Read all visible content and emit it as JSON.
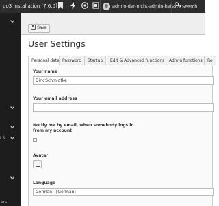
{
  "topbar": {
    "brand": "po3 Installation [7.6.0]",
    "icons": [
      "bookmark-icon",
      "flash-icon",
      "help-icon",
      "system-info-icon"
    ],
    "user_name": "admin-der-nicht-admin-heisst",
    "user_caret": "▾",
    "search_label": "Search"
  },
  "sidebar": {
    "items": [
      {
        "icon": "chevron-down-icon"
      },
      {
        "icon": "chevron-down-icon"
      },
      {
        "icon": "chevron-down-icon"
      },
      {
        "icon": "chevron-down-icon"
      },
      {
        "icon": "chevron-down-icon"
      }
    ],
    "partial_label_1": "LS",
    "partial_label_2": "ers"
  },
  "toolbar": {
    "save_label": "Save"
  },
  "page": {
    "title": "User Settings"
  },
  "tabs": [
    {
      "label": "Personal data",
      "active": true
    },
    {
      "label": "Password",
      "active": false
    },
    {
      "label": "Startup",
      "active": false
    },
    {
      "label": "Edit & Advanced functions",
      "active": false
    },
    {
      "label": "Admin functions",
      "active": false
    },
    {
      "label": "Re",
      "active": false
    }
  ],
  "form": {
    "name_label": "Your name",
    "name_value": "Dirk Schmidtke",
    "email_label": "Your email address",
    "email_value": "",
    "notify_label_line1": "Notify me by email, when somebody logs in",
    "notify_label_line2": "from my account",
    "notify_checked": false,
    "avatar_label": "Avatar",
    "language_label": "Language",
    "language_value": "German - [German]"
  }
}
